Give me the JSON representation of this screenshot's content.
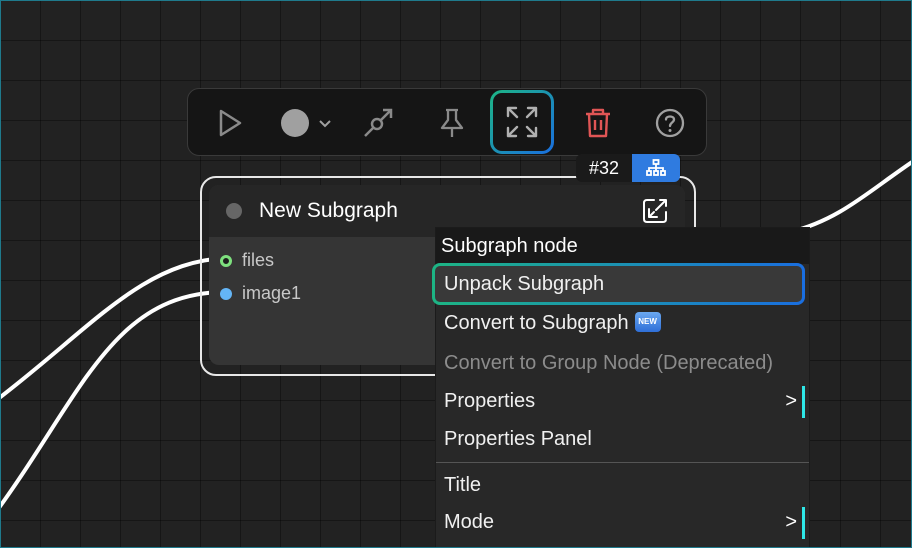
{
  "toolbar": {
    "buttons": [
      {
        "name": "run",
        "icon": "play-icon"
      },
      {
        "name": "color",
        "icon": "color-circle-icon"
      },
      {
        "name": "bypass",
        "icon": "bypass-icon"
      },
      {
        "name": "pin",
        "icon": "pin-icon"
      },
      {
        "name": "fit-view",
        "icon": "expand-arrows-icon"
      },
      {
        "name": "delete",
        "icon": "trash-icon"
      },
      {
        "name": "help",
        "icon": "help-circle-icon"
      }
    ],
    "delete_color": "#e05555",
    "highlight_gradient": [
      "#1db584",
      "#1a6ee0"
    ]
  },
  "node": {
    "id_badge": "#32",
    "badge_color": "#2f7be0",
    "title": "New Subgraph",
    "inputs": [
      {
        "label": "files",
        "color": "#7ee07e"
      },
      {
        "label": "image1",
        "color": "#64b5f6"
      }
    ]
  },
  "context_menu": {
    "header": "Subgraph node",
    "items": [
      {
        "label": "Unpack Subgraph",
        "highlighted": true
      },
      {
        "label": "Convert to Subgraph",
        "badge": "NEW"
      },
      {
        "label": "Convert to Group Node (Deprecated)",
        "disabled": true
      },
      {
        "label": "Properties",
        "submenu_arrow": ">"
      },
      {
        "label": "Properties Panel"
      },
      {
        "label": "Title"
      },
      {
        "label": "Mode",
        "submenu_arrow": ">"
      }
    ]
  }
}
